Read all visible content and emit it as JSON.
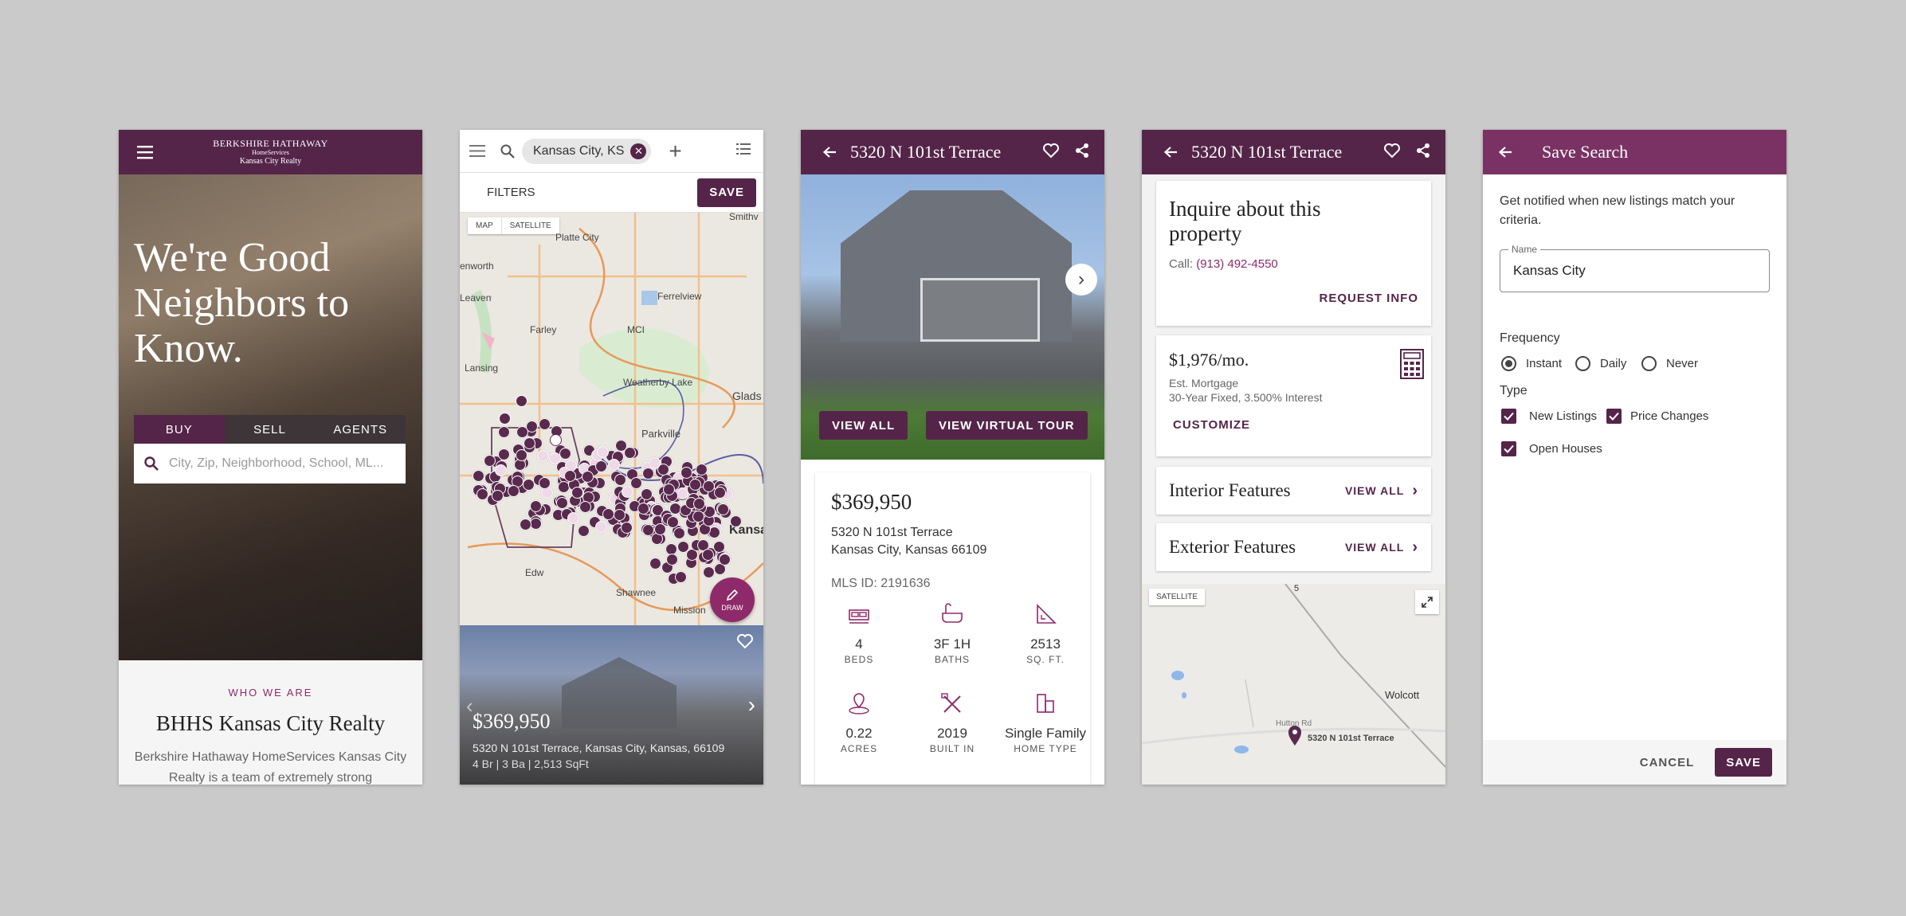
{
  "colors": {
    "brand": "#552549",
    "background": "#cacaca",
    "accent_pink": "#8e2a6a",
    "pin_fill": "#5a2a4e"
  },
  "screen1": {
    "logo_line1": "BERKSHIRE HATHAWAY",
    "logo_line2": "HomeServices",
    "logo_line3": "Kansas City Realty",
    "headline": "We're Good Neighbors to Know.",
    "tabs": [
      "BUY",
      "SELL",
      "AGENTS"
    ],
    "search_placeholder": "City, Zip, Neighborhood, School, ML...",
    "section_eyebrow": "WHO WE ARE",
    "section_title": "BHHS Kansas City Realty",
    "section_body": "Berkshire Hathaway HomeServices Kansas City Realty is a team of extremely strong"
  },
  "screen2": {
    "chip_label": "Kansas City, KS",
    "filters_label": "FILTERS",
    "save_label": "SAVE",
    "map_toggle": [
      "MAP",
      "SATELLITE"
    ],
    "map_labels": [
      "Platte City",
      "Smithv",
      "enworth",
      "Leavenworth",
      "Ferrelview",
      "Farley",
      "MCI",
      "Lansing",
      "Weatherby Lake",
      "Glads",
      "Parkville",
      "Kansas",
      "Edw",
      "Shawnee",
      "Mission"
    ],
    "draw_label": "DRAW",
    "listing_price": "$369,950",
    "listing_address": "5320 N 101st Terrace, Kansas City, Kansas, 66109",
    "listing_meta": "4 Br | 3 Ba | 2,513 SqFt"
  },
  "screen3": {
    "title": "5320 N 101st Terrace",
    "view_all": "VIEW ALL",
    "virtual_tour": "VIEW VIRTUAL TOUR",
    "price": "$369,950",
    "address_line1": "5320 N 101st Terrace",
    "address_line2": "Kansas City, Kansas 66109",
    "mls": "MLS ID: 2191636",
    "stats": [
      {
        "value": "4",
        "label": "BEDS",
        "icon": "bed-icon"
      },
      {
        "value": "3F 1H",
        "label": "BATHS",
        "icon": "bathtub-icon"
      },
      {
        "value": "2513",
        "label": "SQ. FT.",
        "icon": "square-feet-icon"
      },
      {
        "value": "0.22",
        "label": "ACRES",
        "icon": "map-pin-acres-icon"
      },
      {
        "value": "2019",
        "label": "BUILT IN",
        "icon": "tools-icon"
      },
      {
        "value": "Single Family",
        "label": "HOME TYPE",
        "icon": "building-icon"
      }
    ]
  },
  "screen4": {
    "title": "5320 N 101st Terrace",
    "inquire_title": "Inquire about this property",
    "call_prefix": "Call:",
    "phone": "(913) 492-4550",
    "request_info": "REQUEST INFO",
    "mortgage": "$1,976/mo.",
    "mortgage_sub1": "Est. Mortgage",
    "mortgage_sub2": "30-Year Fixed, 3.500% Interest",
    "customize": "CUSTOMIZE",
    "interior": "Interior Features",
    "exterior": "Exterior Features",
    "view_all": "VIEW ALL",
    "satellite": "SATELLITE",
    "map_labels": [
      "Wolcott",
      "Hutton Rd",
      "5320 N 101st Terrace",
      "5"
    ]
  },
  "screen5": {
    "title": "Save Search",
    "intro": "Get notified when new listings match your criteria.",
    "name_label": "Name",
    "name_value": "Kansas City",
    "frequency_label": "Frequency",
    "frequency_options": [
      {
        "label": "Instant",
        "selected": true
      },
      {
        "label": "Daily",
        "selected": false
      },
      {
        "label": "Never",
        "selected": false
      }
    ],
    "type_label": "Type",
    "type_options": [
      {
        "label": "New Listings",
        "checked": true
      },
      {
        "label": "Price Changes",
        "checked": true
      },
      {
        "label": "Open Houses",
        "checked": true
      }
    ],
    "cancel": "CANCEL",
    "save": "SAVE"
  }
}
